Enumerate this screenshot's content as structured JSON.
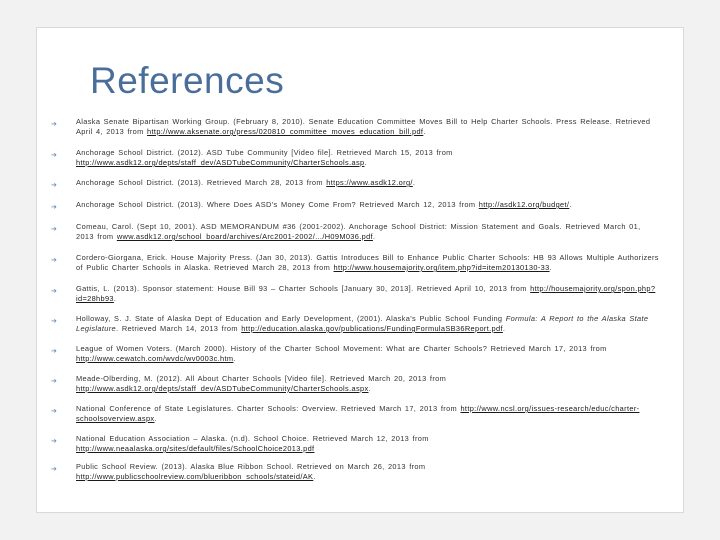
{
  "title": "References",
  "bullet_glyph": "➔",
  "references": [
    {
      "before": "Alaska Senate Bipartisan Working Group. (February 8, 2010). Senate Education Committee Moves Bill to Help Charter Schools. Press Release. Retrieved April 4, 2013 from ",
      "link": "http://www.aksenate.org/press/020810_committee_moves_education_bill.pdf",
      "after": "."
    },
    {
      "before": "Anchorage School District. (2012). ASD Tube Community [Video file]. Retrieved March 15, 2013 from ",
      "link": "http://www.asdk12.org/depts/staff_dev/ASDTubeCommunity/CharterSchools.asp",
      "after": "."
    },
    {
      "before": "Anchorage School District. (2013). Retrieved March 28, 2013 from ",
      "link": "https://www.asdk12.org/",
      "after": "."
    },
    {
      "before": "Anchorage School District. (2013). Where Does ASD’s Money Come From? Retrieved March 12, 2013 from ",
      "link": "http://asdk12.org/budget/",
      "after": "."
    },
    {
      "before": "Comeau, Carol. (Sept 10, 2001). ASD MEMORANDUM #36 (2001-2002). Anchorage School District: Mission Statement and Goals. Retrieved March 01, 2013 from ",
      "link": "www.asdk12.org/school_board/archives/Arc2001-2002/.../H09M036.pdf",
      "after": "."
    },
    {
      "before": "Cordero-Giorgana, Erick. House Majority Press. (Jan 30, 2013). Gattis Introduces Bill to Enhance Public Charter Schools: HB 93 Allows Multiple Authorizers of Public Charter Schools in Alaska. Retrieved March 28, 2013 from ",
      "link": "http://www.housemajority.org/item.php?id=item20130130-33",
      "after": "."
    },
    {
      "before": "Gattis, L. (2013). Sponsor statement: House Bill 93 – Charter Schools [January 30, 2013]. Retrieved April 10, 2013 from ",
      "link": "http://housemajority.org/spon.php?id=28hb93",
      "after": "."
    },
    {
      "before": "Holloway, S. J. State of Alaska Dept of Education and Early Development, (2001). Alaska’s Public School Funding ",
      "em": "Formula: A Report to the Alaska State Legislature",
      "before2": ". Retrieved March 14, 2013 from ",
      "link": "http://education.alaska.gov/publications/FundingFormulaSB36Report.pdf",
      "after": "."
    },
    {
      "before": "League of Women Voters. (March 2000). History of the Charter School Movement: What are Charter Schools? Retrieved March 17, 2013 from ",
      "link": "http://www.cewatch.com/wvdc/wv0003c.htm",
      "after": "."
    },
    {
      "before": "Meade-Olberding, M. (2012). All About Charter Schools [Video file]. Retrieved March 20, 2013 from ",
      "link": "http://www.asdk12.org/depts/staff_dev/ASDTubeCommunity/CharterSchools.aspx",
      "after": "."
    },
    {
      "before": "National Conference of State Legislatures. Charter Schools: Overview. Retrieved March 17, 2013 from ",
      "link": "http://www.ncsl.org/issues-research/educ/charter-schoolsoverview.aspx",
      "after": "."
    },
    {
      "before": "National Education Association – Alaska. (n.d). School Choice. Retrieved March 12, 2013 from ",
      "link": "http://www.neaalaska.org/sites/default/files/SchoolChoice2013.pdf",
      "after": ""
    },
    {
      "before": "Public School Review. (2013). Alaska Blue Ribbon School. Retrieved on March 26, 2013 from ",
      "link": "http://www.publicschoolreview.com/blueribbon_schools/stateid/AK",
      "after": "."
    }
  ]
}
